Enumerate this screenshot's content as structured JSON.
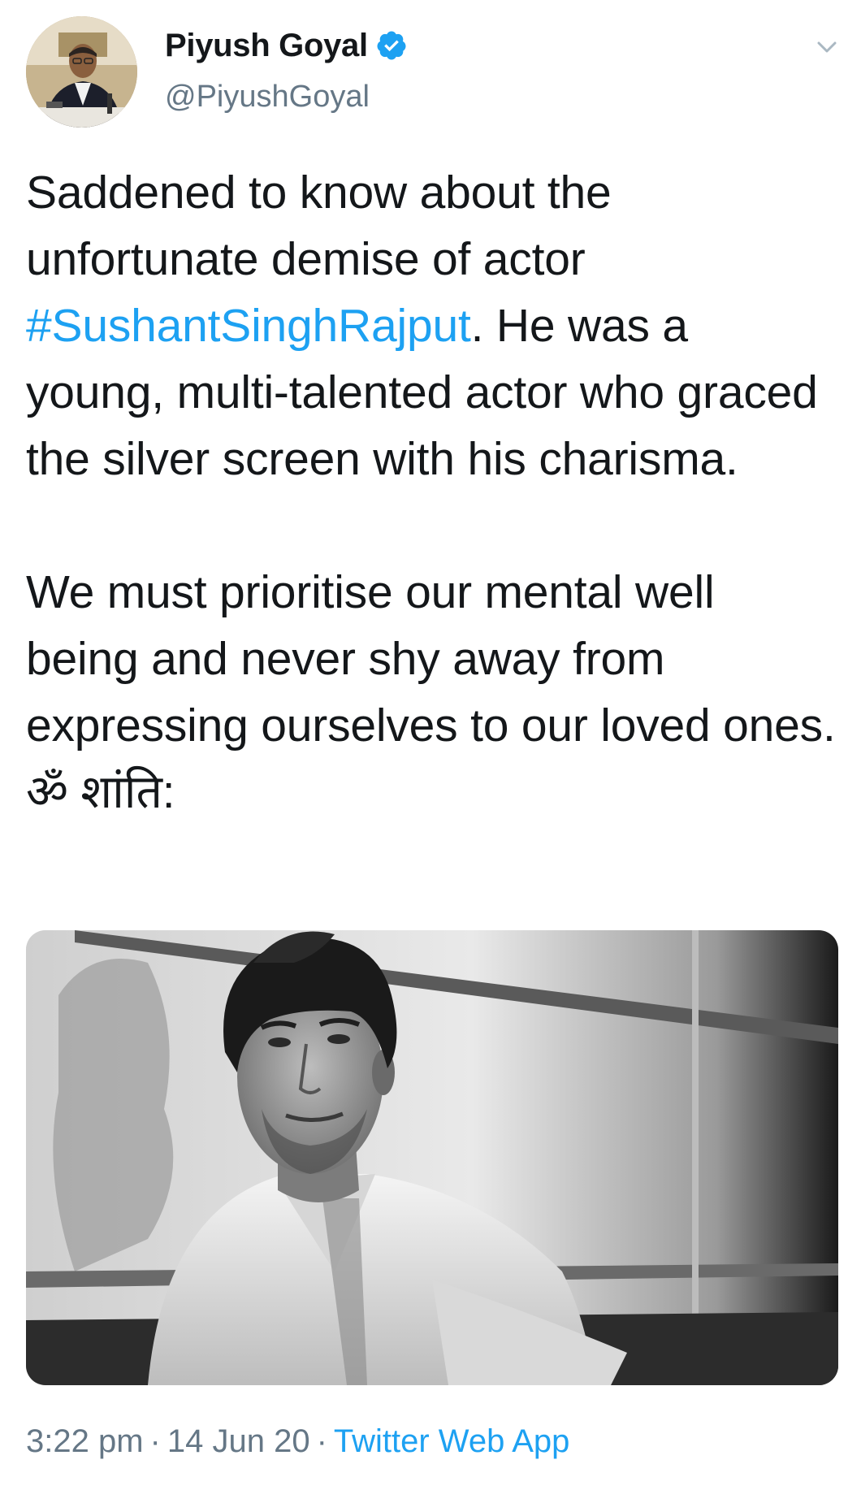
{
  "author": {
    "display_name": "Piyush Goyal",
    "handle": "@PiyushGoyal",
    "verified": true,
    "avatar_icon": "profile-photo"
  },
  "menu_icon": "chevron-down-icon",
  "tweet": {
    "paragraph1_before": "Saddened to know about the unfortunate demise of actor ",
    "hashtag": "#SushantSinghRajput",
    "paragraph1_after": ". He was a young, multi-talented actor who graced the silver screen with his charisma.",
    "paragraph2": "We must prioritise our mental well being and never shy away from expressing ourselves to our loved ones. ॐ शांति:"
  },
  "media": {
    "type": "photo",
    "description_icon": "black-and-white-portrait"
  },
  "meta": {
    "time": "3:22 pm",
    "separator": "·",
    "date": "14 Jun 20",
    "source": "Twitter Web App"
  },
  "colors": {
    "link": "#1da1f2",
    "secondary_text": "#657786",
    "primary_text": "#14171a",
    "verified_badge": "#1da1f2"
  }
}
